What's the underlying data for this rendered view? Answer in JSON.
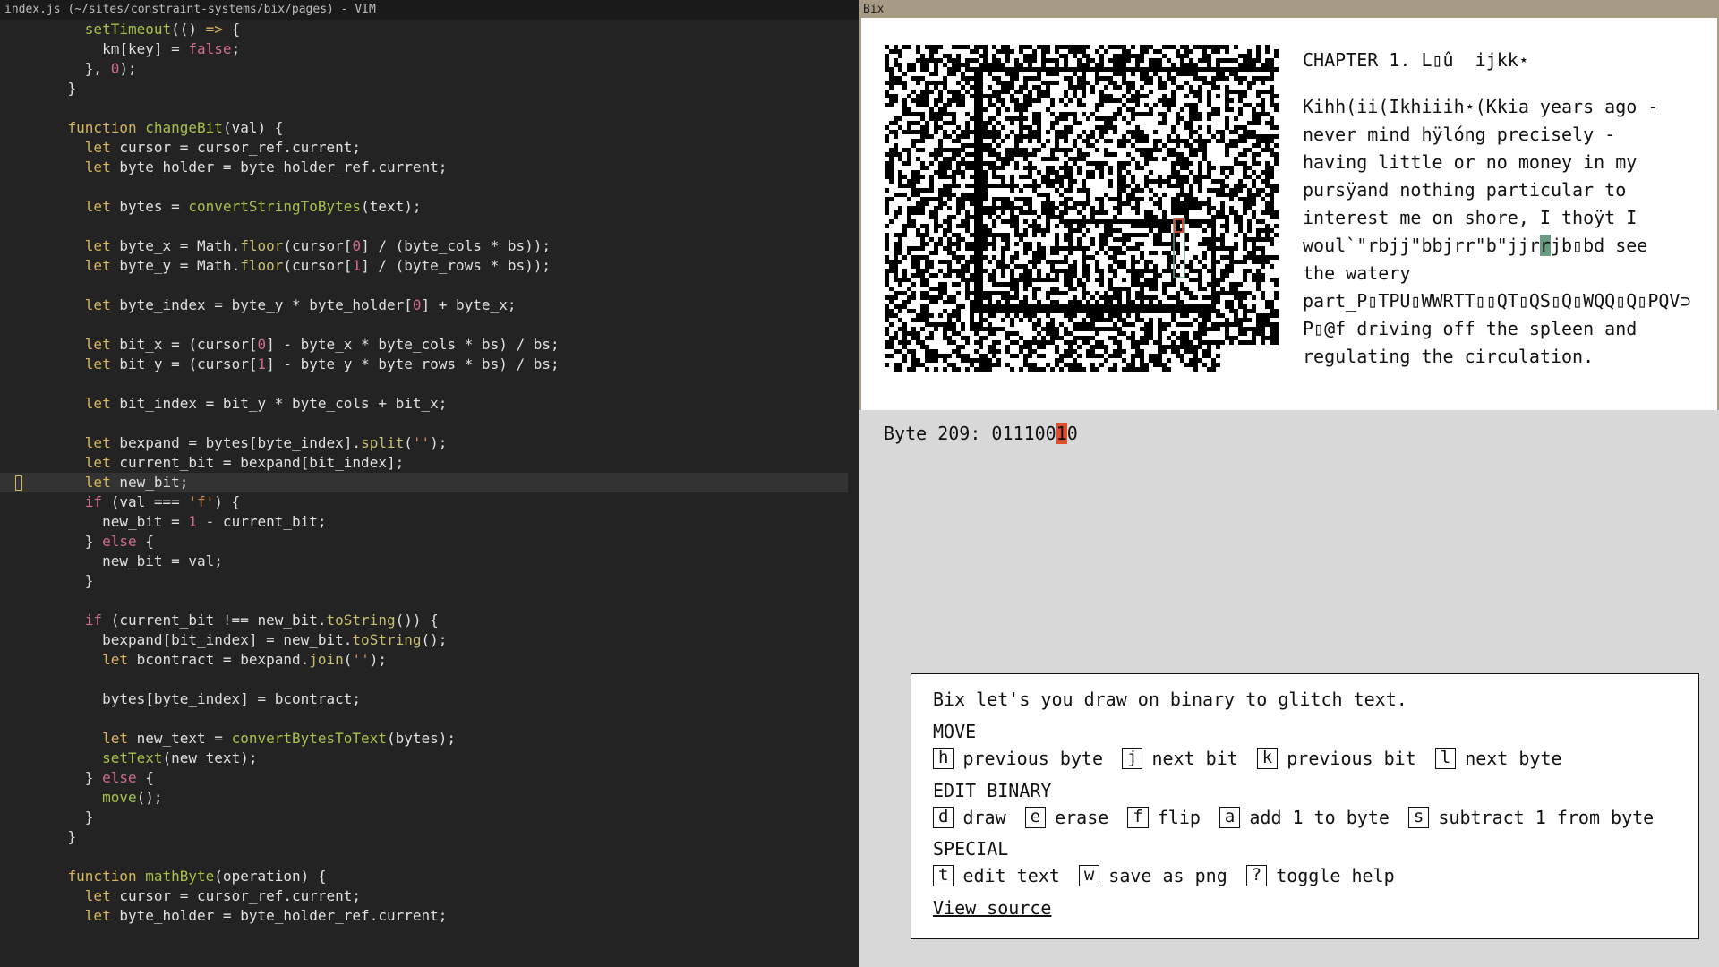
{
  "vim": {
    "title": "index.js (~/sites/constraint-systems/bix/pages) - VIM",
    "lines": [
      [
        [
          "      ",
          ""
        ],
        [
          "setTimeout",
          "fn"
        ],
        [
          "(() ",
          ""
        ],
        [
          "=>",
          "k"
        ],
        [
          " {",
          ""
        ]
      ],
      [
        [
          "        km[key] = ",
          ""
        ],
        [
          "false",
          "n"
        ],
        [
          ";",
          ""
        ]
      ],
      [
        [
          "      }, ",
          ""
        ],
        [
          "0",
          "n"
        ],
        [
          ");",
          ""
        ]
      ],
      [
        [
          "    }",
          ""
        ]
      ],
      [
        [
          "",
          ""
        ]
      ],
      [
        [
          "    ",
          ""
        ],
        [
          "function",
          "k"
        ],
        [
          " ",
          ""
        ],
        [
          "changeBit",
          "fn"
        ],
        [
          "(val) {",
          ""
        ]
      ],
      [
        [
          "      ",
          ""
        ],
        [
          "let",
          "k"
        ],
        [
          " cursor = cursor_ref.current;",
          ""
        ]
      ],
      [
        [
          "      ",
          ""
        ],
        [
          "let",
          "k"
        ],
        [
          " byte_holder = byte_holder_ref.current;",
          ""
        ]
      ],
      [
        [
          "",
          ""
        ]
      ],
      [
        [
          "      ",
          ""
        ],
        [
          "let",
          "k"
        ],
        [
          " bytes = ",
          ""
        ],
        [
          "convertStringToBytes",
          "fn"
        ],
        [
          "(text);",
          ""
        ]
      ],
      [
        [
          "",
          ""
        ]
      ],
      [
        [
          "      ",
          ""
        ],
        [
          "let",
          "k"
        ],
        [
          " byte_x = Math.",
          ""
        ],
        [
          "floor",
          "m"
        ],
        [
          "(cursor[",
          ""
        ],
        [
          "0",
          "n"
        ],
        [
          "] / (byte_cols * bs));",
          ""
        ]
      ],
      [
        [
          "      ",
          ""
        ],
        [
          "let",
          "k"
        ],
        [
          " byte_y = Math.",
          ""
        ],
        [
          "floor",
          "m"
        ],
        [
          "(cursor[",
          ""
        ],
        [
          "1",
          "n"
        ],
        [
          "] / (byte_rows * bs));",
          ""
        ]
      ],
      [
        [
          "",
          ""
        ]
      ],
      [
        [
          "      ",
          ""
        ],
        [
          "let",
          "k"
        ],
        [
          " byte_index = byte_y * byte_holder[",
          ""
        ],
        [
          "0",
          "n"
        ],
        [
          "] + byte_x;",
          ""
        ]
      ],
      [
        [
          "",
          ""
        ]
      ],
      [
        [
          "      ",
          ""
        ],
        [
          "let",
          "k"
        ],
        [
          " bit_x = (cursor[",
          ""
        ],
        [
          "0",
          "n"
        ],
        [
          "] - byte_x * byte_cols * bs) / bs;",
          ""
        ]
      ],
      [
        [
          "      ",
          ""
        ],
        [
          "let",
          "k"
        ],
        [
          " bit_y = (cursor[",
          ""
        ],
        [
          "1",
          "n"
        ],
        [
          "] - byte_y * byte_rows * bs) / bs;",
          ""
        ]
      ],
      [
        [
          "",
          ""
        ]
      ],
      [
        [
          "      ",
          ""
        ],
        [
          "let",
          "k"
        ],
        [
          " bit_index = bit_y * byte_cols + bit_x;",
          ""
        ]
      ],
      [
        [
          "",
          ""
        ]
      ],
      [
        [
          "      ",
          ""
        ],
        [
          "let",
          "k"
        ],
        [
          " bexpand = bytes[byte_index].",
          ""
        ],
        [
          "split",
          "m"
        ],
        [
          "(",
          ""
        ],
        [
          "''",
          "s"
        ],
        [
          ");",
          ""
        ]
      ],
      [
        [
          "      ",
          ""
        ],
        [
          "let",
          "k"
        ],
        [
          " current_bit = bexpand[bit_index];",
          ""
        ]
      ],
      [
        [
          "      ",
          ""
        ],
        [
          "let",
          "k"
        ],
        [
          " new_bit;",
          ""
        ]
      ],
      [
        [
          "      ",
          ""
        ],
        [
          "if",
          "n"
        ],
        [
          " (val === ",
          ""
        ],
        [
          "'f'",
          "s"
        ],
        [
          ") {",
          ""
        ]
      ],
      [
        [
          "        new_bit = ",
          ""
        ],
        [
          "1",
          "n"
        ],
        [
          " - current_bit;",
          ""
        ]
      ],
      [
        [
          "      } ",
          ""
        ],
        [
          "else",
          "n"
        ],
        [
          " {",
          ""
        ]
      ],
      [
        [
          "        new_bit = val;",
          ""
        ]
      ],
      [
        [
          "      }",
          ""
        ]
      ],
      [
        [
          "",
          ""
        ]
      ],
      [
        [
          "      ",
          ""
        ],
        [
          "if",
          "n"
        ],
        [
          " (current_bit !== new_bit.",
          ""
        ],
        [
          "toString",
          "m"
        ],
        [
          "()) {",
          ""
        ]
      ],
      [
        [
          "        bexpand[bit_index] = new_bit.",
          ""
        ],
        [
          "toString",
          "m"
        ],
        [
          "();",
          ""
        ]
      ],
      [
        [
          "        ",
          ""
        ],
        [
          "let",
          "k"
        ],
        [
          " bcontract = bexpand.",
          ""
        ],
        [
          "join",
          "m"
        ],
        [
          "(",
          ""
        ],
        [
          "''",
          "s"
        ],
        [
          ");",
          ""
        ]
      ],
      [
        [
          "",
          ""
        ]
      ],
      [
        [
          "        bytes[byte_index] = bcontract;",
          ""
        ]
      ],
      [
        [
          "",
          ""
        ]
      ],
      [
        [
          "        ",
          ""
        ],
        [
          "let",
          "k"
        ],
        [
          " new_text = ",
          ""
        ],
        [
          "convertBytesToText",
          "fn"
        ],
        [
          "(bytes);",
          ""
        ]
      ],
      [
        [
          "        ",
          ""
        ],
        [
          "setText",
          "fn"
        ],
        [
          "(new_text);",
          ""
        ]
      ],
      [
        [
          "      } ",
          ""
        ],
        [
          "else",
          "n"
        ],
        [
          " {",
          ""
        ]
      ],
      [
        [
          "        ",
          ""
        ],
        [
          "move",
          "fn"
        ],
        [
          "();",
          ""
        ]
      ],
      [
        [
          "      }",
          ""
        ]
      ],
      [
        [
          "    }",
          ""
        ]
      ],
      [
        [
          "",
          ""
        ]
      ],
      [
        [
          "    ",
          ""
        ],
        [
          "function",
          "k"
        ],
        [
          " ",
          ""
        ],
        [
          "mathByte",
          "fn"
        ],
        [
          "(operation) {",
          ""
        ]
      ],
      [
        [
          "      ",
          ""
        ],
        [
          "let",
          "k"
        ],
        [
          " cursor = cursor_ref.current;",
          ""
        ]
      ],
      [
        [
          "      ",
          ""
        ],
        [
          "let",
          "k"
        ],
        [
          " byte_holder = byte_holder_ref.current;",
          ""
        ]
      ]
    ],
    "colors": {
      "keyword": "#d7b55b",
      "function": "#a6c24a",
      "method": "#c8c070",
      "number": "#d26b8f",
      "string": "#d58a5a"
    }
  },
  "bix": {
    "title": "Bix",
    "chapter": "CHAPTER 1. L▯û  ijkk⋆",
    "paragraph_before": "Kihh(ii(Ikhiiih⋆(Kkia years ago -\nnever mind hÿlóng precisely -\nhaving little or no money in my\npursÿand nothing particular to\ninterest me on shore, I thoÿt I\nwoul`\"rbjj\"bbjrr\"b\"jjr",
    "paragraph_highlight": "r",
    "paragraph_after": "jb▯bd see\nthe watery\npart_P▯TPU▯WWRTT▯▯QT▯QS▯Q▯WQQ▯Q▯PQV⊃\nP▯@f driving off the spleen and\nregulating the circulation.",
    "byte_label": "Byte 209: ",
    "byte_bits_before": "011100",
    "byte_bit_current": "1",
    "byte_bits_after": "0",
    "help": {
      "intro": "Bix let's you draw on binary to glitch text.",
      "move_heading": "MOVE",
      "move": [
        {
          "key": "h",
          "label": "previous byte"
        },
        {
          "key": "j",
          "label": "next bit"
        },
        {
          "key": "k",
          "label": "previous bit"
        },
        {
          "key": "l",
          "label": "next byte"
        }
      ],
      "edit_heading": "EDIT BINARY",
      "edit": [
        {
          "key": "d",
          "label": "draw"
        },
        {
          "key": "e",
          "label": "erase"
        },
        {
          "key": "f",
          "label": "flip"
        },
        {
          "key": "a",
          "label": "add 1 to byte"
        },
        {
          "key": "s",
          "label": "subtract 1 from byte"
        }
      ],
      "special_heading": "SPECIAL",
      "special": [
        {
          "key": "t",
          "label": "edit text"
        },
        {
          "key": "w",
          "label": "save as png"
        },
        {
          "key": "?",
          "label": "toggle help"
        }
      ],
      "view_source": "View source"
    },
    "colors": {
      "frame": "#a79b83",
      "highlight": "#6a9a80",
      "bit_cursor": "#e04d2b"
    }
  }
}
